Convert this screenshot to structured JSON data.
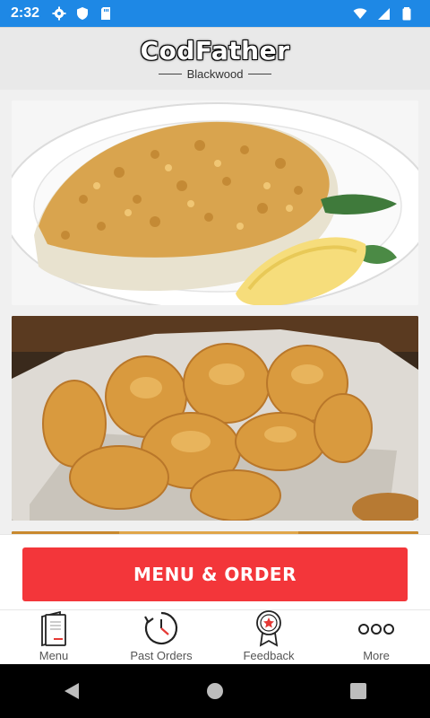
{
  "status_bar": {
    "time": "2:32",
    "icons_left": [
      "settings-icon",
      "shield-icon",
      "sd-card-icon"
    ],
    "icons_right": [
      "wifi-icon",
      "cell-signal-icon",
      "battery-icon"
    ]
  },
  "header": {
    "brand": "CodFather",
    "location": "Blackwood"
  },
  "images": [
    {
      "name": "baked-fish-with-breadcrumbs"
    },
    {
      "name": "fried-nuggets-in-basket"
    },
    {
      "name": "partial-food-image"
    }
  ],
  "cta": {
    "label": "MENU & ORDER",
    "color": "#f3363a"
  },
  "tabs": [
    {
      "label": "Menu",
      "icon": "menu-book-icon"
    },
    {
      "label": "Past Orders",
      "icon": "history-clock-icon"
    },
    {
      "label": "Feedback",
      "icon": "award-star-icon"
    },
    {
      "label": "More",
      "icon": "more-dots-icon"
    }
  ],
  "nav": [
    "back-icon",
    "home-icon",
    "recents-icon"
  ],
  "colors": {
    "status_bar": "#1e88e5",
    "accent": "#f3363a"
  }
}
